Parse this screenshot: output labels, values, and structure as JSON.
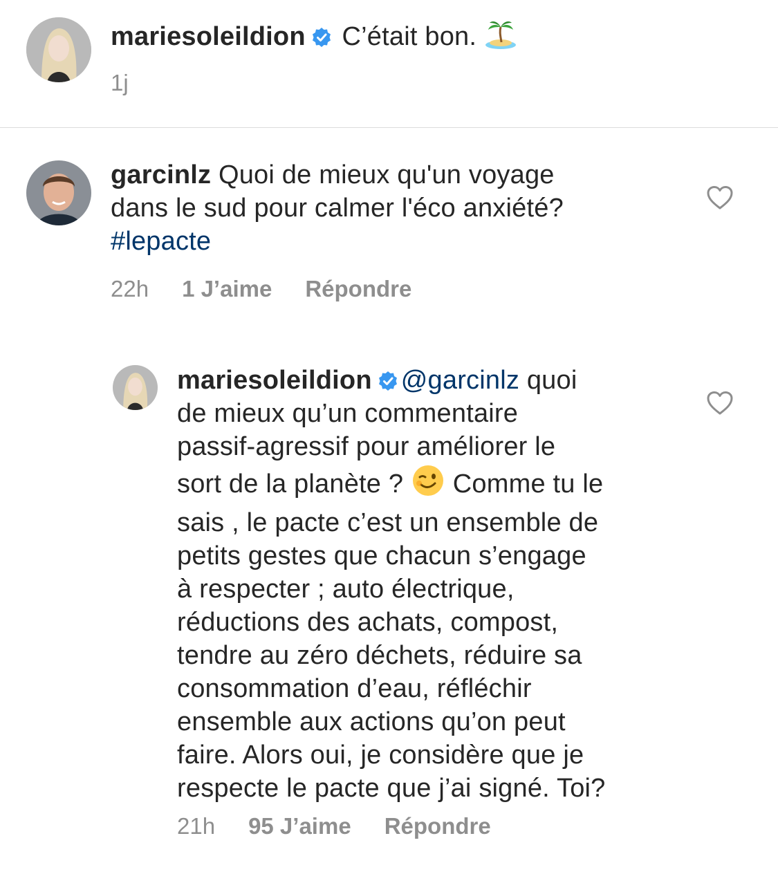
{
  "caption": {
    "username": "mariesoleildion",
    "text": "C’était bon.",
    "emoji": "desert-island",
    "time": "1j"
  },
  "comment1": {
    "username": "garcinlz",
    "text_line1": "Quoi de mieux qu'un voyage",
    "text_line2": "dans le sud pour calmer l'éco anxiété?",
    "hashtag": "#lepacte",
    "time": "22h",
    "likes": "1 J’aime",
    "reply": "Répondre"
  },
  "reply1": {
    "username": "mariesoleildion",
    "mention": "@garcinlz",
    "first_tail": "quoi",
    "line2": "de mieux qu’un commentaire",
    "line3": "passif-agressif pour améliorer le",
    "line4a": "sort de la planète ?",
    "line4b": "Comme tu le",
    "emoji": "winking-face",
    "line5": "sais , le pacte c’est un ensemble de",
    "line6": "petits gestes que chacun s’engage",
    "line7": "à respecter ; auto électrique,",
    "line8": "réductions des achats, compost,",
    "line9": "tendre au zéro déchets, réduire sa",
    "line10": "consommation d’eau, réfléchir",
    "line11": "ensemble aux actions qu’on peut",
    "line12": "faire. Alors oui, je considère que je",
    "line13": "respecte le pacte que j’ai signé. Toi?",
    "time": "21h",
    "likes": "95 J’aime",
    "reply": "Répondre"
  },
  "colors": {
    "text": "#262626",
    "meta": "#8e8e8e",
    "link": "#003569",
    "verified": "#3897f0",
    "divider": "#dbdbdb"
  }
}
